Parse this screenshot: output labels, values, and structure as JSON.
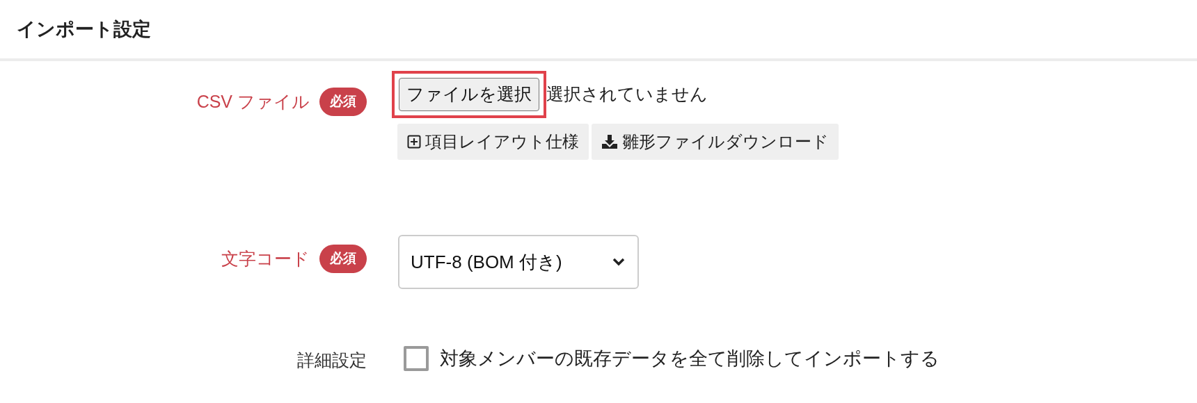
{
  "header": {
    "title": "インポート設定"
  },
  "fields": [
    {
      "kind": "file",
      "label": "CSV ファイル",
      "required": true,
      "badge": "必須",
      "button": "ファイルを選択",
      "status": "選択されていません",
      "highlighted": true,
      "links": [
        {
          "kind": "expand",
          "label": "項目レイアウト仕様"
        },
        {
          "kind": "download",
          "label": "雛形ファイルダウンロード"
        }
      ]
    },
    {
      "kind": "select",
      "label": "文字コード",
      "required": true,
      "badge": "必須",
      "value": "UTF-8 (BOM 付き)"
    },
    {
      "kind": "checkbox",
      "label": "詳細設定",
      "required": false,
      "option": "対象メンバーの既存データを全て削除してインポートする",
      "checked": false
    }
  ]
}
